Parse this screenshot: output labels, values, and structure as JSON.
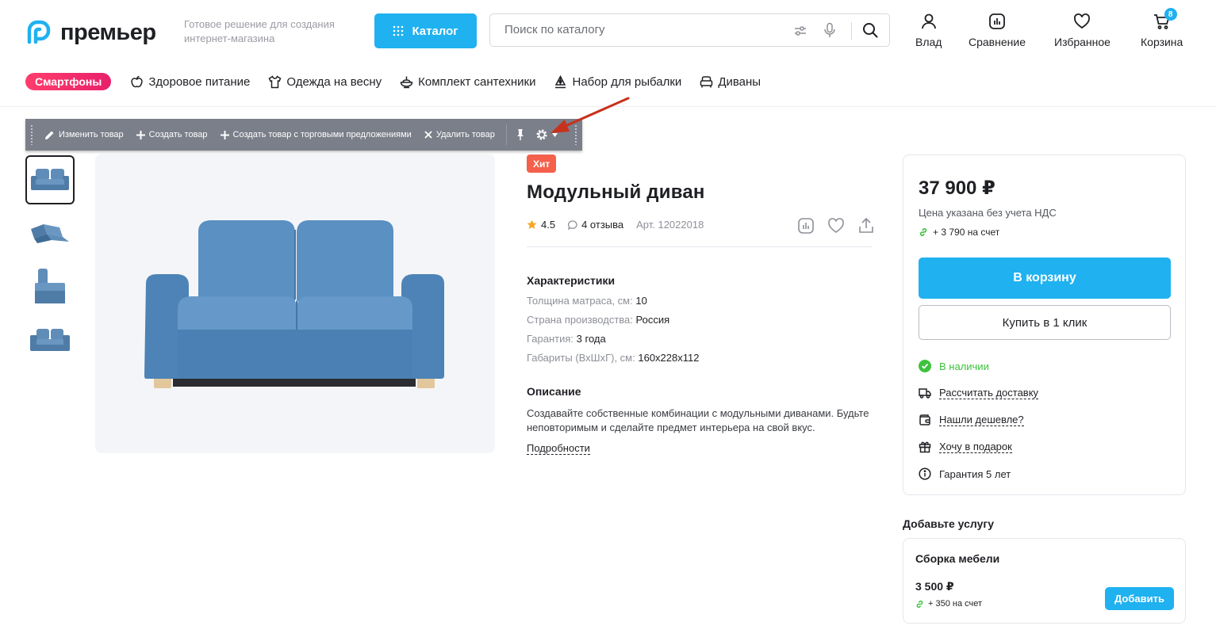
{
  "header": {
    "logo_text": "премьер",
    "tagline": "Готовое решение для создания интернет-магазина",
    "catalog_label": "Каталог",
    "search_placeholder": "Поиск по каталогу",
    "user_label": "Влад",
    "compare_label": "Сравнение",
    "favorites_label": "Избранное",
    "cart_label": "Корзина",
    "cart_count": "8",
    "brand_color": "#1fb1f0"
  },
  "nav": {
    "promo": "Смартфоны",
    "items": [
      {
        "label": "Здоровое питание",
        "icon": "apple-icon"
      },
      {
        "label": "Одежда на весну",
        "icon": "shirt-icon"
      },
      {
        "label": "Комплект сантехники",
        "icon": "toilet-icon"
      },
      {
        "label": "Набор для рыбалки",
        "icon": "fishing-icon"
      },
      {
        "label": "Диваны",
        "icon": "sofa-icon"
      }
    ]
  },
  "admin_panel": {
    "edit": "Изменить товар",
    "create": "Создать товар",
    "create_offers": "Создать товар с торговыми предложениями",
    "delete": "Удалить товар"
  },
  "product": {
    "badge": "Хит",
    "title": "Модульный диван",
    "rating": "4.5",
    "reviews": "4 отзыва",
    "article": "Арт. 12022018",
    "characteristics_title": "Характеристики",
    "characteristics": [
      {
        "key": "Толщина матраса, см:",
        "value": "10"
      },
      {
        "key": "Страна производства:",
        "value": "Россия"
      },
      {
        "key": "Гарантия:",
        "value": "3 года"
      },
      {
        "key": "Габариты (ВхШхГ), см:",
        "value": "160x228x112"
      }
    ],
    "description_title": "Описание",
    "description": "Создавайте собственные комбинации с модульными диванами. Будьте неповторимым и сделайте предмет интерьера на свой вкус.",
    "more_link": "Подробности"
  },
  "buy": {
    "price": "37 900 ₽",
    "vat_note": "Цена указана без учета НДС",
    "bonus": "+ 3 790 на счет",
    "add_to_cart": "В корзину",
    "one_click": "Купить в 1 клик",
    "in_stock": "В наличии",
    "delivery": "Рассчитать доставку",
    "cheaper": "Нашли дешевле?",
    "gift": "Хочу в подарок",
    "warranty": "Гарантия 5 лет"
  },
  "services": {
    "title": "Добавьте услугу",
    "name": "Сборка мебели",
    "price": "3 500 ₽",
    "bonus": "+ 350 на счет",
    "add": "Добавить"
  }
}
